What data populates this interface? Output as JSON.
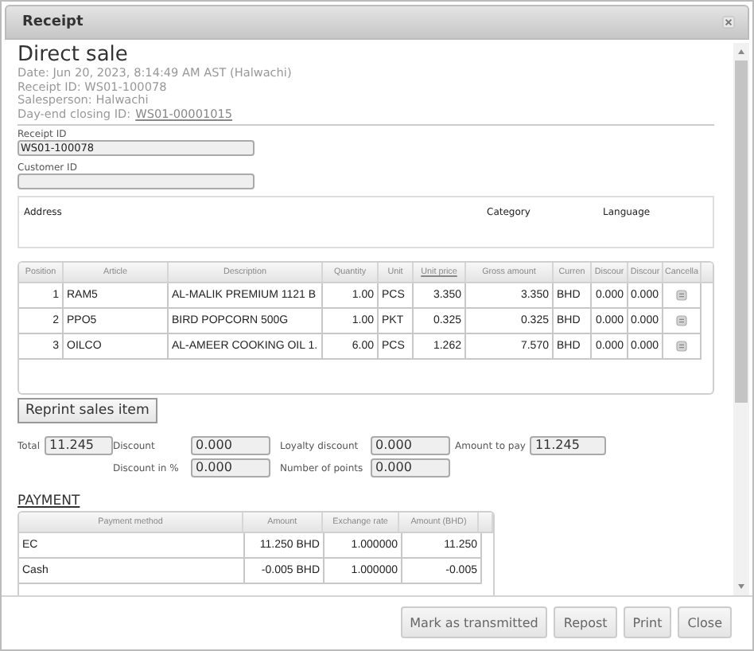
{
  "window": {
    "title": "Receipt"
  },
  "header": {
    "title": "Direct sale",
    "lines": [
      "Date: Jun 20, 2023, 8:14:49 AM AST (Halwachi)",
      "Receipt ID: WS01-100078",
      "Salesperson: Halwachi"
    ],
    "closing_label": "Day-end closing ID:",
    "closing_link": "WS01-00001015"
  },
  "fields": [
    {
      "label": "Receipt ID",
      "value": "WS01-100078"
    },
    {
      "label": "Customer ID"
    }
  ],
  "address_panel": {
    "columns": [
      "Address",
      "Category",
      "Language"
    ]
  },
  "items_table": {
    "columns": [
      {
        "label": "Position",
        "kind": "text",
        "sorted": false
      },
      {
        "label": "Article",
        "kind": "text",
        "sorted": false
      },
      {
        "label": "Description",
        "kind": "text",
        "sorted": false
      },
      {
        "label": "Quantity",
        "kind": "text",
        "sorted": false
      },
      {
        "label": "Unit",
        "kind": "text",
        "sorted": false
      },
      {
        "label": "Unit price",
        "kind": "text",
        "sorted": true
      },
      {
        "label": "Gross amount",
        "kind": "text",
        "sorted": false
      },
      {
        "label": "Curren",
        "kind": "text",
        "sorted": false
      },
      {
        "label": "Discour",
        "kind": "text",
        "sorted": false
      },
      {
        "label": "Discour",
        "kind": "text",
        "sorted": false
      },
      {
        "label": "Cancella",
        "kind": "icon",
        "sorted": false
      }
    ],
    "rows": [
      [
        "1",
        "RAM5",
        "AL-MALIK PREMIUM 1121 B",
        "1.00",
        "PCS",
        "3.350",
        "3.350",
        "BHD",
        "0.000",
        "0.000"
      ],
      [
        "2",
        "PPO5",
        "BIRD POPCORN 500G",
        "1.00",
        "PKT",
        "0.325",
        "0.325",
        "BHD",
        "0.000",
        "0.000"
      ],
      [
        "3",
        "OILCO",
        "AL-AMEER COOKING OIL 1.",
        "6.00",
        "PCS",
        "1.262",
        "7.570",
        "BHD",
        "0.000",
        "0.000"
      ]
    ]
  },
  "reprint_button": "Reprint sales item",
  "totals": {
    "row_1": [
      {
        "label": "Total",
        "value": "11.245"
      },
      {
        "label": "Discount",
        "value": "0.000"
      },
      {
        "label": "Loyalty discount",
        "value": "0.000"
      },
      {
        "label": "Amount to pay",
        "value": "11.245"
      }
    ],
    "row_2": [
      {
        "label": "Discount in %",
        "value": "0.000"
      },
      {
        "label": "Number of points",
        "value": "0.000"
      }
    ]
  },
  "payment": {
    "title": "PAYMENT",
    "columns": [
      {
        "label": "Payment method",
        "kind": "text",
        "sorted": false
      },
      {
        "label": "Amount",
        "kind": "text",
        "sorted": false
      },
      {
        "label": "Exchange rate",
        "kind": "text",
        "sorted": false
      },
      {
        "label": "Amount (BHD)",
        "kind": "text",
        "sorted": false
      }
    ],
    "rows": [
      [
        "EC",
        "11.250 BHD",
        "1.000000",
        "11.250"
      ],
      [
        "Cash",
        "-0.005 BHD",
        "1.000000",
        "-0.005"
      ]
    ]
  },
  "buttons": [
    "Mark as transmitted",
    "Repost",
    "Print",
    "Close"
  ]
}
